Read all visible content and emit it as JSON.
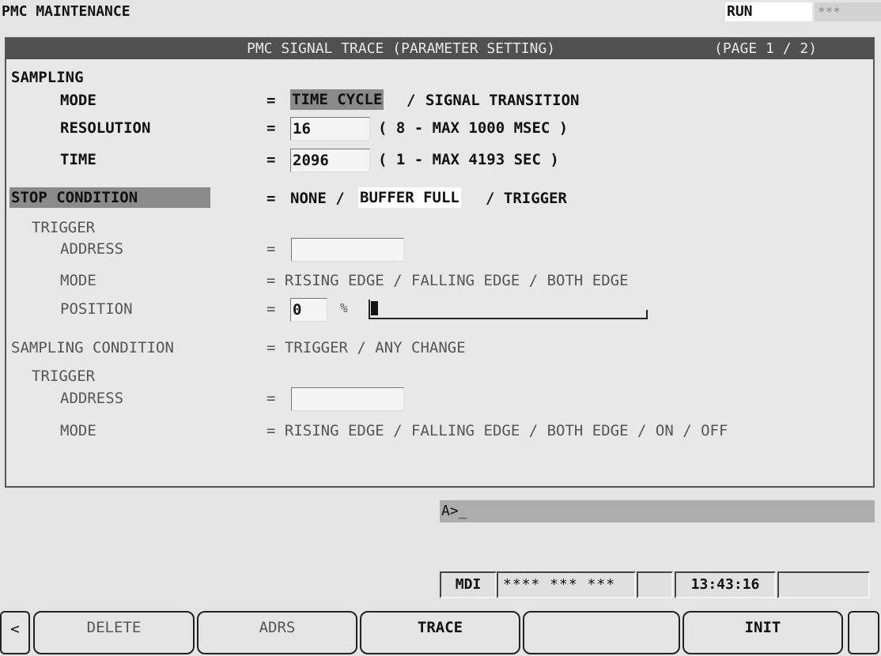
{
  "screen": {
    "title": "PMC MAINTENANCE",
    "run_status": "RUN",
    "run_stars": "***"
  },
  "panel": {
    "title": "PMC SIGNAL TRACE (PARAMETER SETTING)",
    "page": "(PAGE  1 / 2)"
  },
  "sampling": {
    "heading": "SAMPLING",
    "mode_label": "MODE",
    "mode_eq": "=",
    "mode_opt1": "TIME CYCLE",
    "mode_sep": "/",
    "mode_opt2": "SIGNAL TRANSITION",
    "resolution_label": "RESOLUTION",
    "resolution_eq": "=",
    "resolution_value": "16",
    "resolution_range": "( 8 - MAX 1000 MSEC )",
    "time_label": "TIME",
    "time_eq": "=",
    "time_value": "2096",
    "time_range": "( 1 - MAX 4193 SEC )"
  },
  "stop_condition": {
    "heading": "STOP CONDITION",
    "eq": "=",
    "opt1": "NONE /",
    "opt2": "BUFFER FULL",
    "opt3": "/ TRIGGER",
    "trigger_heading": "TRIGGER",
    "address_label": "ADDRESS",
    "address_eq": "=",
    "address_value": "",
    "mode_label": "MODE",
    "mode_text": "= RISING EDGE / FALLING EDGE / BOTH EDGE",
    "position_label": "POSITION",
    "position_eq": "=",
    "position_value": "0",
    "position_unit": "%",
    "position_fraction": 0
  },
  "sampling_condition": {
    "heading": "SAMPLING CONDITION",
    "options_text": "= TRIGGER / ANY CHANGE",
    "trigger_heading": "TRIGGER",
    "address_label": "ADDRESS",
    "address_eq": "=",
    "address_value": "",
    "mode_label": "MODE",
    "mode_text": "= RISING EDGE / FALLING EDGE / BOTH EDGE / ON / OFF"
  },
  "command_line": {
    "text": "A>_"
  },
  "status_bar": {
    "mode": "MDI",
    "stars": "**** *** ***",
    "blank1": "",
    "clock": "13:43:16",
    "blank2": ""
  },
  "softkeys": {
    "left_arrow": "<",
    "key1": "DELETE",
    "key2": "ADRS",
    "key3": "TRACE",
    "key4": "",
    "key5": "INIT",
    "right_key": ""
  },
  "colors": {
    "background": "#e4e4e4",
    "header_bar": "#505050",
    "highlight": "#8a8a8a",
    "command_bar": "#adadad"
  }
}
